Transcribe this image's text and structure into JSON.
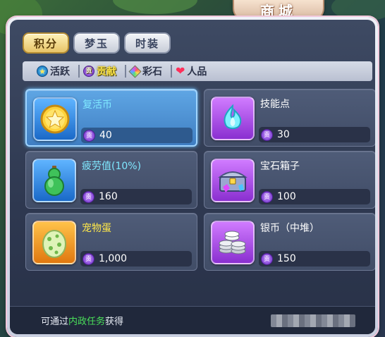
{
  "title": "商城",
  "tabs": [
    {
      "label": "积分",
      "active": true
    },
    {
      "label": "梦玉",
      "active": false
    },
    {
      "label": "时装",
      "active": false
    }
  ],
  "currencies": [
    {
      "label": "活跃",
      "icon": "star-coin-icon",
      "active": false
    },
    {
      "label": "贡献",
      "icon": "contribution-coin-icon",
      "active": true
    },
    {
      "label": "彩石",
      "icon": "rainbow-stone-icon",
      "active": false
    },
    {
      "label": "人品",
      "icon": "heart-icon",
      "active": false
    }
  ],
  "price_icon_glyph": "贡",
  "items": [
    {
      "name": "复活币",
      "price": "40",
      "icon": "gold-star-coin-icon",
      "selected": true
    },
    {
      "name": "技能点",
      "price": "30",
      "icon": "blue-flame-icon",
      "selected": false
    },
    {
      "name": "疲劳值(10%)",
      "price": "160",
      "icon": "green-gourd-icon",
      "selected": false
    },
    {
      "name": "宝石箱子",
      "price": "100",
      "icon": "gem-chest-icon",
      "selected": false
    },
    {
      "name": "宠物蛋",
      "price": "1,000",
      "icon": "spotted-egg-icon",
      "selected": false
    },
    {
      "name": "银币（中堆）",
      "price": "150",
      "icon": "silver-coin-stack-icon",
      "selected": false
    }
  ],
  "footer": {
    "prefix": "可通过",
    "highlight": "内政任务",
    "suffix": "获得"
  },
  "colors": {
    "selected_border": "#9fd4ff",
    "active_currency": "#f7e14a",
    "footer_highlight": "#4ae05a"
  }
}
